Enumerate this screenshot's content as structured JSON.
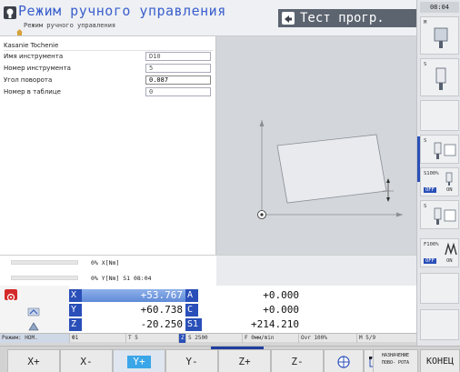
{
  "header": {
    "mode_title": "Режим ручного управления",
    "mode_subtitle": "Режим ручного управления",
    "program_title": "Тест прогр.",
    "clock": "08:04"
  },
  "form": {
    "title": "Kasanie Tochenie",
    "rows": [
      {
        "label": "Имя инструмента",
        "value": "D10",
        "active": false
      },
      {
        "label": "Номер инструмента",
        "value": "5",
        "active": false
      },
      {
        "label": "Угол поворота",
        "value": "0.087",
        "active": true
      },
      {
        "label": "Номер в таблице",
        "value": "0",
        "active": false
      }
    ]
  },
  "feed": {
    "x_text": "0% X[Nm]",
    "y_text": "0% Y[Nm] S1  08:04",
    "x_percent": 0,
    "y_percent": 0
  },
  "positions": {
    "left": [
      {
        "axis": "X",
        "value": "+53.767",
        "highlight": true
      },
      {
        "axis": "Y",
        "value": "+60.738",
        "highlight": false
      },
      {
        "axis": "Z",
        "value": "-20.250",
        "highlight": false
      }
    ],
    "right": [
      {
        "axis": "A",
        "value": "+0.000"
      },
      {
        "axis": "C",
        "value": "+0.000"
      },
      {
        "axis": "S1",
        "value": "+214.210"
      }
    ]
  },
  "status_bar": {
    "mode": "Режим: НОМ.",
    "tool_icon": "Ф1",
    "tool": "T 5",
    "tool_axis": "Z",
    "spindle": "S 2500",
    "feed": "F 0мм/min",
    "override": "Ovr 100%",
    "mfunc": "M 5/9"
  },
  "sidebar": {
    "clock": "08:04",
    "labels": {
      "m": "M",
      "s": "S",
      "s2": "S",
      "s100": "S100%",
      "off1": "OFF",
      "on1": "ON",
      "s3": "S",
      "f100": "F100%",
      "off2": "OFF",
      "on2": "ON"
    }
  },
  "softkeys": [
    {
      "label": "X+"
    },
    {
      "label": "X-"
    },
    {
      "label": "Y+",
      "active": true
    },
    {
      "label": "Y-"
    },
    {
      "label": "Z+"
    },
    {
      "label": "Z-"
    },
    {
      "label": ""
    },
    {
      "label": ""
    },
    {
      "label": "НАЗНАЧЕНИЕ ПОВО- РОТА"
    },
    {
      "label": "КОНЕЦ"
    }
  ],
  "colors": {
    "title_blue": "#3a5fcd",
    "axis_blue": "#2a4fb8",
    "highlight_blue": "#6d97e0",
    "header_dark": "#5c6470",
    "alarm_red": "#d42a2a"
  }
}
